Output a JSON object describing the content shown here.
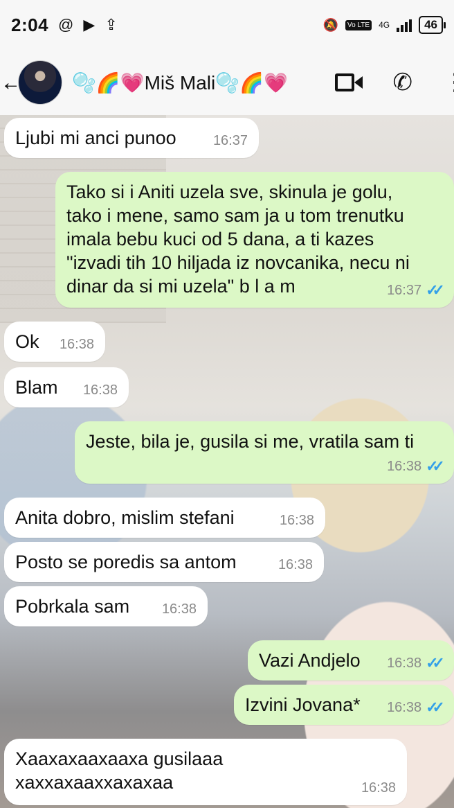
{
  "status_bar": {
    "time": "2:04",
    "icons": [
      "threads-icon",
      "play-icon",
      "upload-icon"
    ],
    "network": "4G",
    "lte_badge": "Vo LTE",
    "battery": "46"
  },
  "header": {
    "contact_name": "🫧🌈💗Miš Mali🫧🌈💗",
    "icons": [
      "back-arrow-icon",
      "video-call-icon",
      "voice-call-icon",
      "more-options-icon"
    ]
  },
  "messages": [
    {
      "dir": "in",
      "text": "Ljubi mi anci punoo",
      "time": "16:37"
    },
    {
      "dir": "out",
      "text": "Tako si i Aniti uzela sve, skinula je golu,\ntako i mene, samo sam ja u tom trenutku\nimala bebu kuci od 5 dana, a ti kazes\n\"izvadi tih 10 hiljada iz novcanika, necu ni\ndinar da si mi uzela\" b l a m",
      "time": "16:37",
      "read": true
    },
    {
      "dir": "in",
      "text": "Ok",
      "time": "16:38"
    },
    {
      "dir": "in",
      "text": "Blam",
      "time": "16:38"
    },
    {
      "dir": "out",
      "text": "Jeste, bila je, gusila si me, vratila sam ti",
      "time": "16:38",
      "read": true
    },
    {
      "dir": "in",
      "text": "Anita dobro, mislim stefani",
      "time": "16:38"
    },
    {
      "dir": "in",
      "text": "Posto se poredis sa antom",
      "time": "16:38"
    },
    {
      "dir": "in",
      "text": "Pobrkala sam",
      "time": "16:38"
    },
    {
      "dir": "out",
      "text": "Vazi Andjelo",
      "time": "16:38",
      "read": true
    },
    {
      "dir": "out",
      "text": "Izvini Jovana*",
      "time": "16:38",
      "read": true
    },
    {
      "dir": "in",
      "text": "Xaaxaxaaxaaxa gusilaaa\nxaxxaxaaxxaxaxaa",
      "time": "16:38"
    }
  ],
  "colors": {
    "incoming_bubble": "#ffffff",
    "outgoing_bubble": "#dcf8c6",
    "read_ticks": "#34a0e8"
  }
}
